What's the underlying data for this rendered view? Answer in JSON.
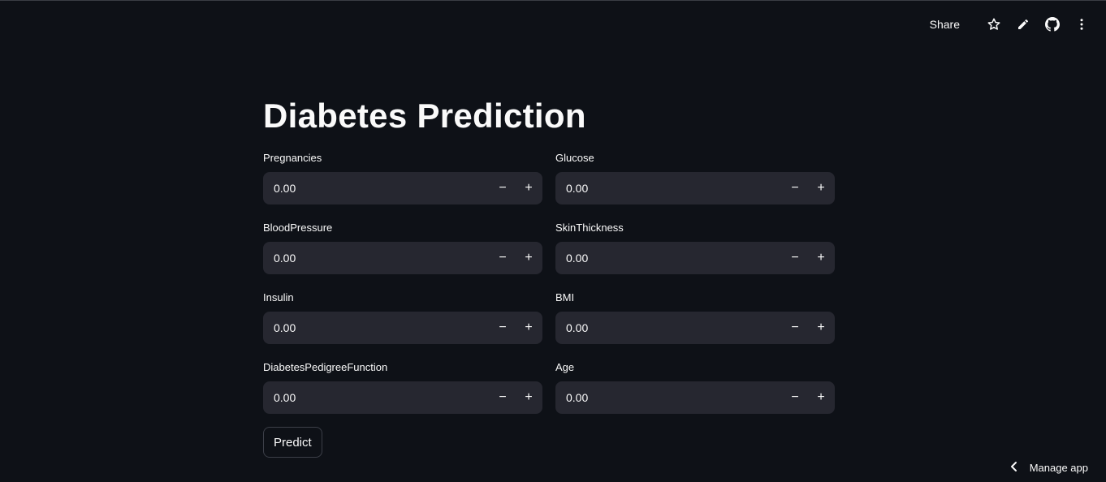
{
  "toolbar": {
    "share_label": "Share",
    "icons": [
      "star-icon",
      "pencil-icon",
      "github-icon",
      "more-vertical-icon"
    ]
  },
  "page": {
    "title": "Diabetes Prediction"
  },
  "fields": [
    {
      "label": "Pregnancies",
      "value": "0.00"
    },
    {
      "label": "Glucose",
      "value": "0.00"
    },
    {
      "label": "BloodPressure",
      "value": "0.00"
    },
    {
      "label": "SkinThickness",
      "value": "0.00"
    },
    {
      "label": "Insulin",
      "value": "0.00"
    },
    {
      "label": "BMI",
      "value": "0.00"
    },
    {
      "label": "DiabetesPedigreeFunction",
      "value": "0.00"
    },
    {
      "label": "Age",
      "value": "0.00"
    }
  ],
  "stepper": {
    "minus": "−",
    "plus": "+"
  },
  "predict_button": {
    "label": "Predict"
  },
  "footer": {
    "manage_label": "Manage app"
  },
  "colors": {
    "background": "#0e1117",
    "input_bg": "#262730",
    "text": "#fafafa"
  }
}
